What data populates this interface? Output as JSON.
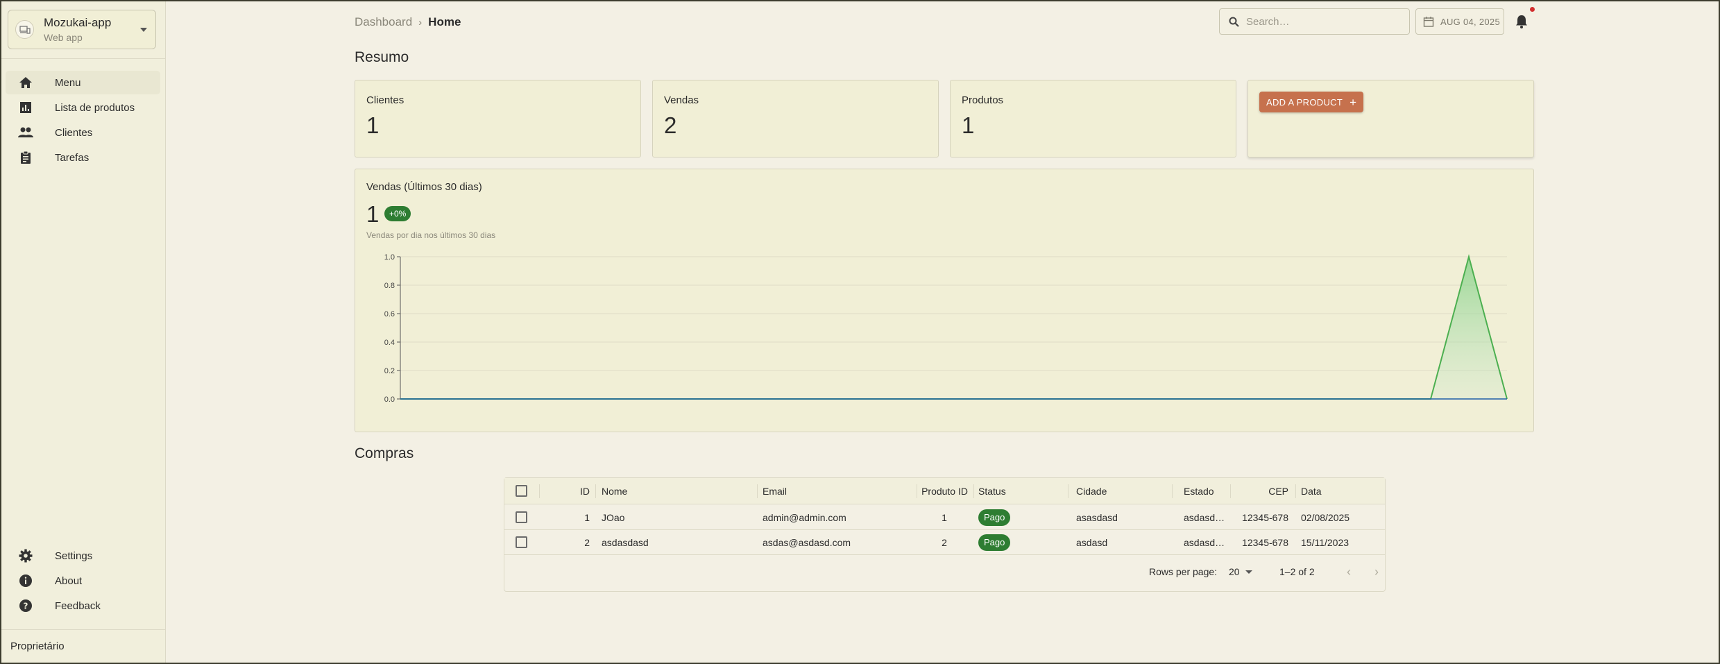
{
  "sidebar": {
    "app_name": "Mozukai-app",
    "app_subtitle": "Web app",
    "app_icon": "devices-icon",
    "nav": [
      {
        "label": "Menu",
        "icon": "home-icon",
        "active": true
      },
      {
        "label": "Lista de produtos",
        "icon": "bar-chart-icon"
      },
      {
        "label": "Clientes",
        "icon": "people-icon"
      },
      {
        "label": "Tarefas",
        "icon": "clipboard-icon"
      }
    ],
    "bottom_nav": [
      {
        "label": "Settings",
        "icon": "gear-icon"
      },
      {
        "label": "About",
        "icon": "info-icon"
      },
      {
        "label": "Feedback",
        "icon": "help-icon"
      }
    ],
    "footer": "Proprietário"
  },
  "breadcrumb": {
    "parent": "Dashboard",
    "separator": "›",
    "current": "Home"
  },
  "topbar": {
    "search_placeholder": "Search…",
    "date": "AUG 04, 2025",
    "notification_dot_color": "#d32f2f"
  },
  "resumo": {
    "title": "Resumo",
    "cards": [
      {
        "label": "Clientes",
        "value": "1"
      },
      {
        "label": "Vendas",
        "value": "2"
      },
      {
        "label": "Produtos",
        "value": "1"
      }
    ],
    "add_button": "ADD A PRODUCT",
    "add_button_color": "#c6714d"
  },
  "sales": {
    "title": "Vendas (Últimos 30 dias)",
    "value": "1",
    "badge": "+0%",
    "badge_color": "#2e7d32",
    "subtitle": "Vendas por dia nos últimos 30 dias"
  },
  "chart_data": {
    "type": "area",
    "title": "Vendas (Últimos 30 dias)",
    "xlabel": "",
    "ylabel": "",
    "ylim": [
      0,
      1
    ],
    "y_ticks": [
      "0.0",
      "0.2",
      "0.4",
      "0.6",
      "0.8",
      "1.0"
    ],
    "x": [
      1,
      2,
      3,
      4,
      5,
      6,
      7,
      8,
      9,
      10,
      11,
      12,
      13,
      14,
      15,
      16,
      17,
      18,
      19,
      20,
      21,
      22,
      23,
      24,
      25,
      26,
      27,
      28,
      29,
      30
    ],
    "series": [
      {
        "values": [
          0,
          0,
          0,
          0,
          0,
          0,
          0,
          0,
          0,
          0,
          0,
          0,
          0,
          0,
          0,
          0,
          0,
          0,
          0,
          0,
          0,
          0,
          0,
          0,
          0,
          0,
          0,
          0,
          1,
          0
        ],
        "color": "#4caf50"
      }
    ],
    "grid": true
  },
  "compras": {
    "title": "Compras",
    "columns": [
      "ID",
      "Nome",
      "Email",
      "Produto ID",
      "Status",
      "Cidade",
      "Estado",
      "CEP",
      "Data"
    ],
    "rows": [
      {
        "id": "1",
        "nome": "JOao",
        "email": "admin@admin.com",
        "produto_id": "1",
        "status": "Pago",
        "cidade": "asasdasd",
        "estado": "asdasd…",
        "cep": "12345-678",
        "data": "02/08/2025"
      },
      {
        "id": "2",
        "nome": "asdasdasd",
        "email": "asdas@asdasd.com",
        "produto_id": "2",
        "status": "Pago",
        "cidade": "asdasd",
        "estado": "asdasd…",
        "cep": "12345-678",
        "data": "15/11/2023"
      }
    ],
    "status_color": "#2e7d32",
    "pager": {
      "rows_label": "Rows per page:",
      "rows_value": "20",
      "range": "1–2 of 2"
    }
  }
}
